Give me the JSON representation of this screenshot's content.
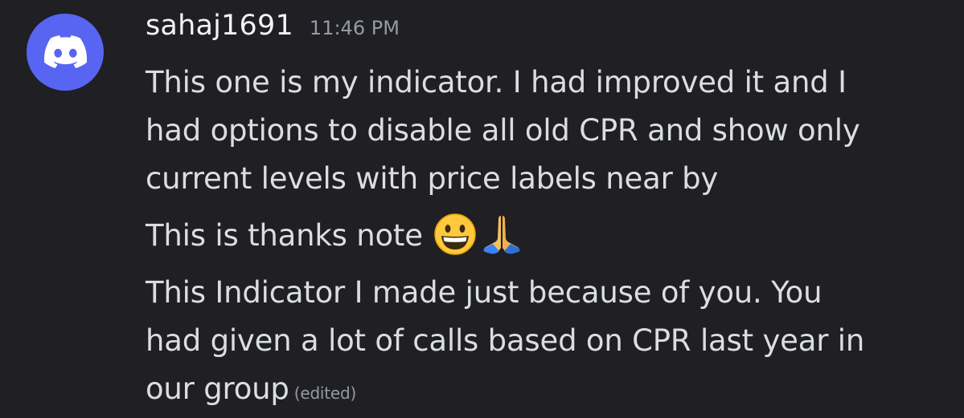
{
  "message": {
    "author": "sahaj1691",
    "timestamp": "11:46 PM",
    "lines": [
      "This one is my indicator. I had improved it and I",
      "had options to disable all old CPR and show only",
      "current levels with price labels near by",
      "This is thanks note ",
      "This Indicator I made just because of you. You",
      "had given a lot of calls based on CPR last year in",
      "our group"
    ],
    "edited_label": "(edited)",
    "emojis": [
      "grinning-face-icon",
      "folded-hands-icon"
    ]
  },
  "colors": {
    "background": "#1f1f24",
    "avatar": "#5865f2",
    "text": "#dbdee1",
    "muted": "#949ba4"
  }
}
